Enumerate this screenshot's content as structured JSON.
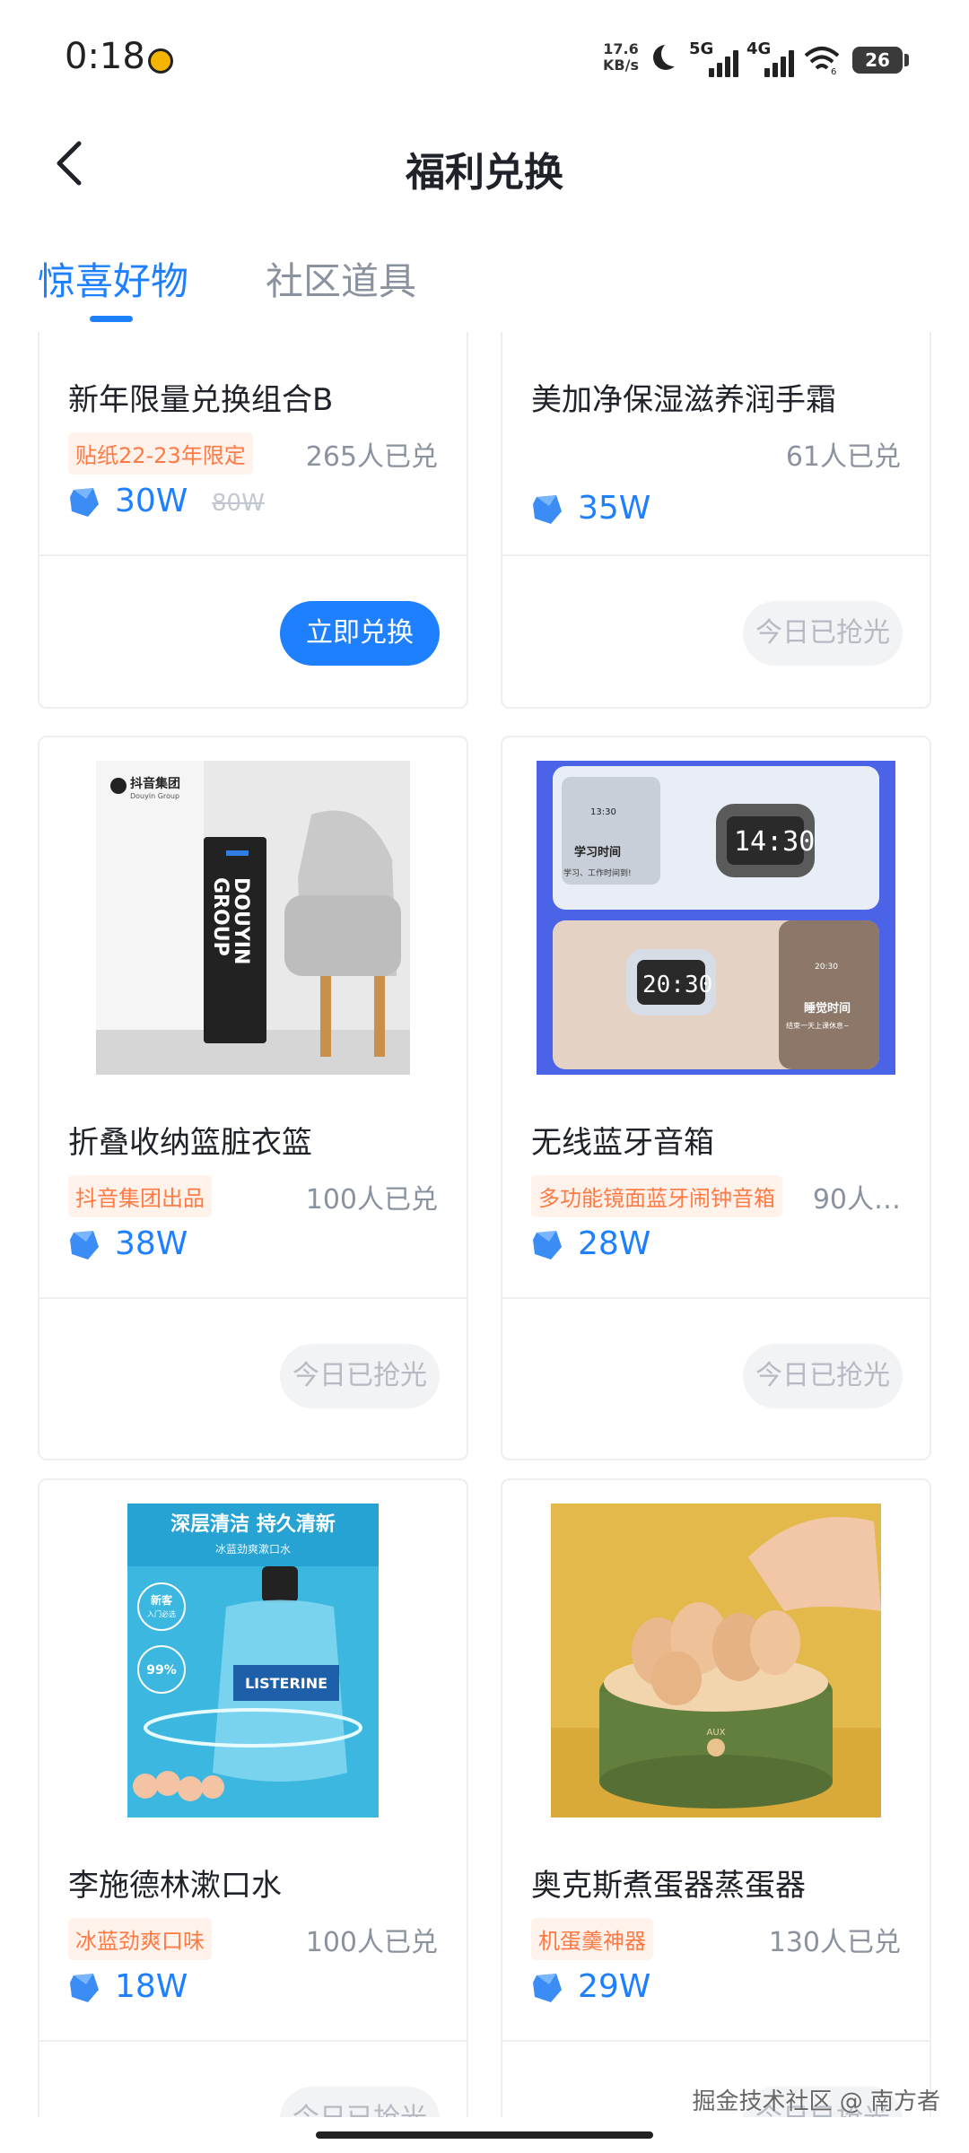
{
  "status_bar": {
    "time": "0:18",
    "net_speed": "17.6",
    "net_unit": "KB/s",
    "sig1": "5G",
    "sig2": "4G",
    "wifi_sub": "6",
    "battery": "26"
  },
  "header": {
    "title": "福利兑换"
  },
  "tabs": [
    {
      "label": "惊喜好物",
      "active": true
    },
    {
      "label": "社区道具",
      "active": false
    }
  ],
  "products": [
    {
      "name": "新年限量兑换组合B",
      "tag": "贴纸22-23年限定",
      "count": "265人已兑",
      "price": "30W",
      "old_price": "80W",
      "button": "立即兑换",
      "button_state": "primary"
    },
    {
      "name": "美加净保湿滋养润手霜",
      "tag": "",
      "count": "61人已兑",
      "price": "35W",
      "old_price": "",
      "button": "今日已抢光",
      "button_state": "disabled"
    },
    {
      "name": "折叠收纳篮脏衣篮",
      "tag": "抖音集团出品",
      "count": "100人已兑",
      "price": "38W",
      "old_price": "",
      "button": "今日已抢光",
      "button_state": "disabled",
      "image_text": [
        "抖音集团",
        "Douyin Group",
        "DOUYIN",
        "GROUP"
      ]
    },
    {
      "name": "无线蓝牙音箱",
      "tag": "多功能镜面蓝牙闹钟音箱",
      "count": "90人…",
      "price": "28W",
      "old_price": "",
      "button": "今日已抢光",
      "button_state": "disabled",
      "image_text": [
        "学习时间",
        "学习、工作时间到!",
        "14:30",
        "20:30",
        "睡觉时间",
        "结束一天上课休息~",
        "13:30",
        "20:30"
      ]
    },
    {
      "name": "李施德林漱口水",
      "tag": "冰蓝劲爽口味",
      "count": "100人已兑",
      "price": "18W",
      "old_price": "",
      "button": "今日已抢光",
      "button_state": "disabled",
      "image_text": [
        "深层清洁 持久清新",
        "冰蓝劲爽漱口水",
        "新客",
        "入门必选",
        "99%",
        "LISTERINE"
      ]
    },
    {
      "name": "奥克斯煮蛋器蒸蛋器",
      "tag": "机蛋羹神器",
      "count": "130人已兑",
      "price": "29W",
      "old_price": "",
      "button": "今日已抢光",
      "button_state": "disabled",
      "image_text": [
        "AUX"
      ]
    }
  ],
  "watermark": "掘金技术社区 @ 南方者",
  "colors": {
    "accent": "#1e80ff",
    "tag_text": "#ff7a45",
    "tag_bg": "#fff2ea",
    "muted": "#8a919f"
  }
}
